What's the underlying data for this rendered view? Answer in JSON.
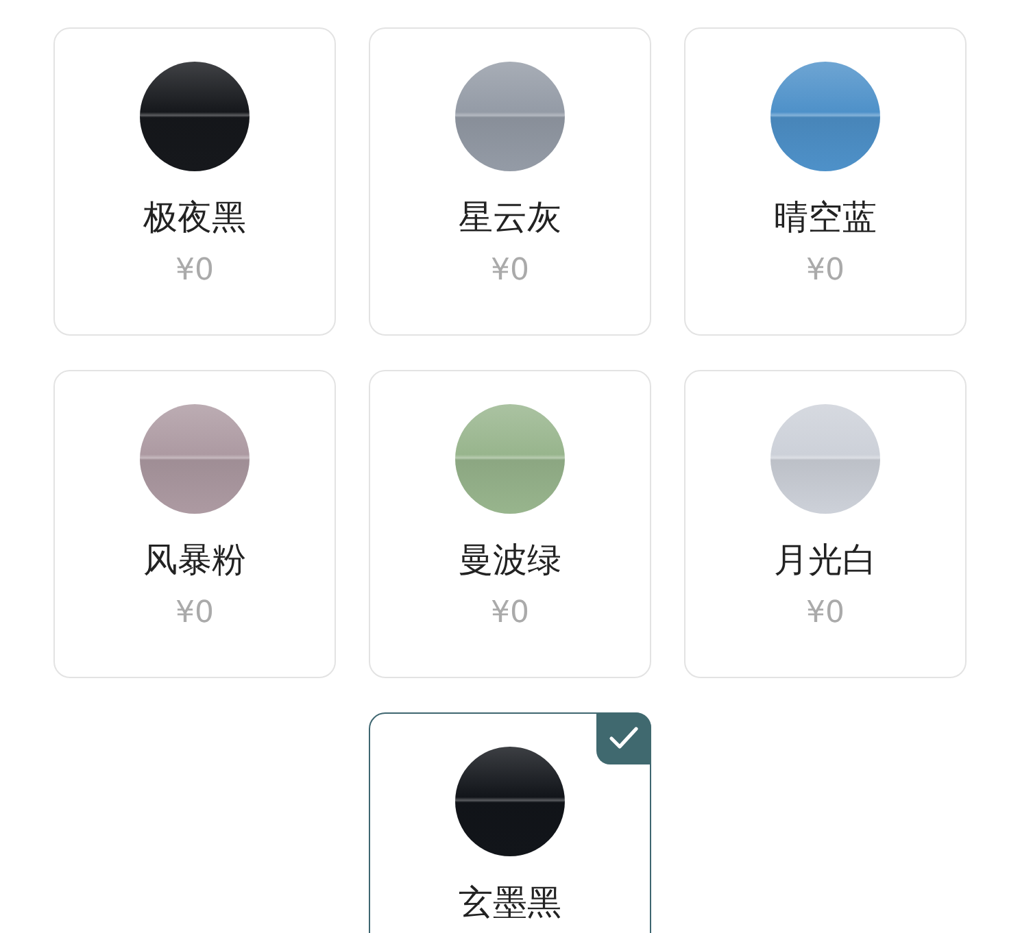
{
  "colors": [
    {
      "name": "极夜黑",
      "price": "¥0",
      "color": "#16181c",
      "selected": false
    },
    {
      "name": "星云灰",
      "price": "¥0",
      "color": "#949ba6",
      "selected": false
    },
    {
      "name": "晴空蓝",
      "price": "¥0",
      "color": "#4e91c9",
      "selected": false
    },
    {
      "name": "风暴粉",
      "price": "¥0",
      "color": "#ad9aa2",
      "selected": false
    },
    {
      "name": "曼波绿",
      "price": "¥0",
      "color": "#98b58d",
      "selected": false
    },
    {
      "name": "月光白",
      "price": "¥0",
      "color": "#cdd1d9",
      "selected": false
    },
    {
      "name": "玄墨黑",
      "color": "#12151a",
      "selected": true
    }
  ]
}
